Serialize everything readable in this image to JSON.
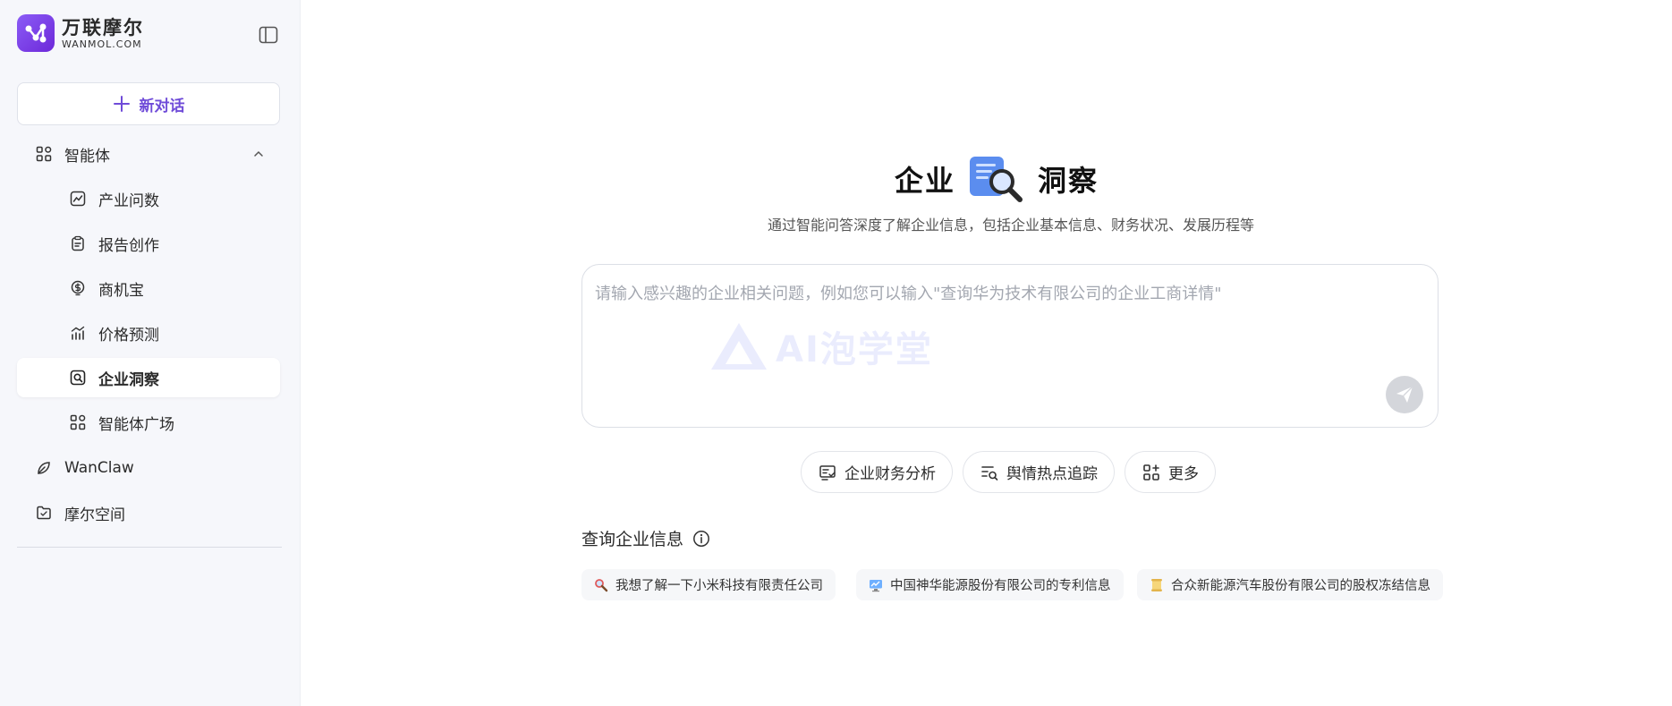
{
  "brand": {
    "name": "万联摩尔",
    "domain": "WANMOL.COM"
  },
  "sidebar": {
    "new_chat_label": "新对话",
    "agents_group": "智能体",
    "sub_items": [
      "产业问数",
      "报告创作",
      "商机宝",
      "价格预测",
      "企业洞察",
      "智能体广场"
    ],
    "active_item": "企业洞察",
    "items": [
      "WanClaw",
      "摩尔空间"
    ]
  },
  "main": {
    "hero_left": "企业",
    "hero_right": "洞察",
    "subtitle": "通过智能问答深度了解企业信息，包括企业基本信息、财务状况、发展历程等",
    "input_placeholder": "请输入感兴趣的企业相关问题，例如您可以输入\"查询华为技术有限公司的企业工商详情\"",
    "watermark": "AI泡学堂",
    "chips": [
      "企业财务分析",
      "舆情热点追踪",
      "更多"
    ],
    "section_title": "查询企业信息",
    "suggestions": [
      "我想了解一下小米科技有限责任公司",
      "中国神华能源股份有限公司的专利信息",
      "合众新能源汽车股份有限公司的股权冻结信息"
    ]
  },
  "colors": {
    "accent": "#6f4bd8",
    "sidebar_bg": "#f6f7fb",
    "chip_border": "#e3e5ea"
  }
}
